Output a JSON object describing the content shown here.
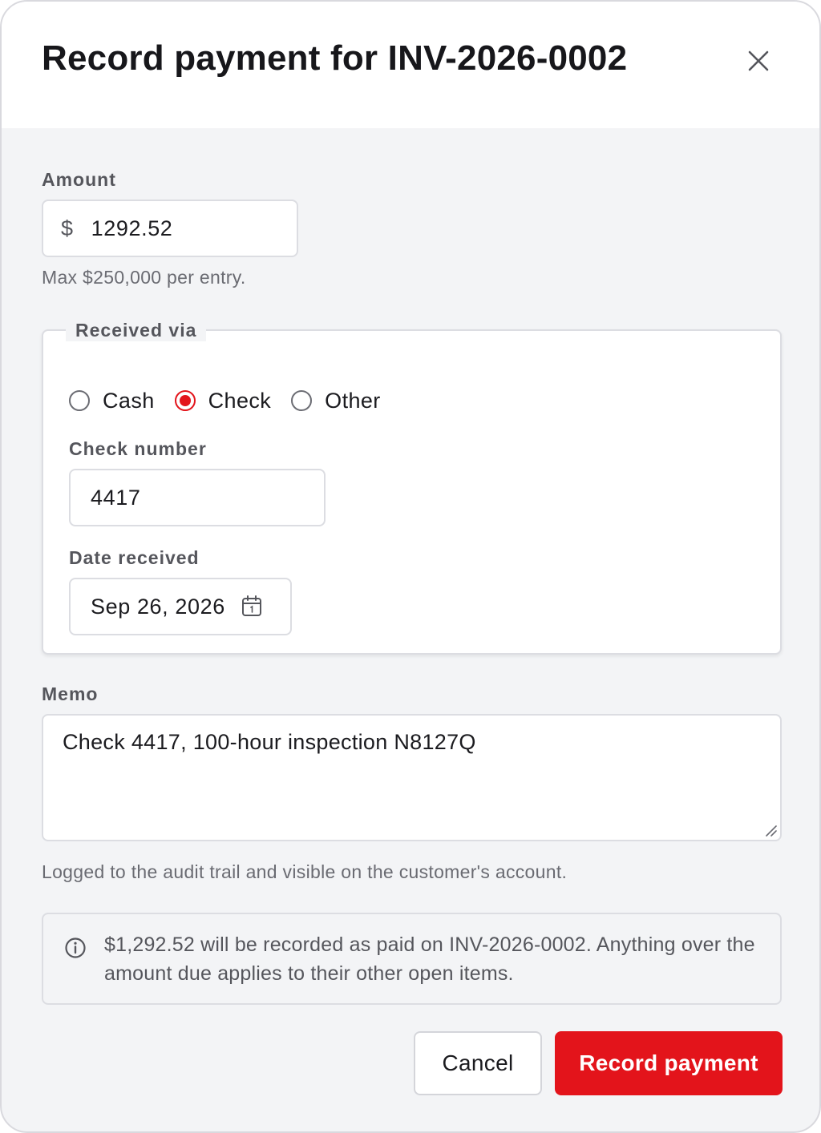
{
  "dialog": {
    "title": "Record payment for INV-2026-0002",
    "close_icon": "close-icon"
  },
  "amount": {
    "label": "Amount",
    "currency_symbol": "$",
    "value": "1292.52",
    "hint": "Max $250,000 per entry."
  },
  "received_via": {
    "legend": "Received via",
    "options": [
      {
        "label": "Cash",
        "checked": false
      },
      {
        "label": "Check",
        "checked": true
      },
      {
        "label": "Other",
        "checked": false
      }
    ],
    "check_number_label": "Check number",
    "check_number_value": "4417",
    "date_label": "Date received",
    "date_value": "Sep 26, 2026",
    "date_icon": "calendar-icon"
  },
  "memo": {
    "label": "Memo",
    "value": "Check 4417, 100-hour inspection N8127Q",
    "hint": "Logged to the audit trail and visible on the customer's account."
  },
  "info": {
    "icon": "info-icon",
    "text": "$1,292.52 will be recorded as paid on INV-2026-0002. Anything over the amount due applies to their other open items."
  },
  "actions": {
    "cancel_label": "Cancel",
    "submit_label": "Record payment"
  },
  "colors": {
    "accent": "#e3141b",
    "background": "#f3f4f6",
    "border": "#dcdde2"
  }
}
